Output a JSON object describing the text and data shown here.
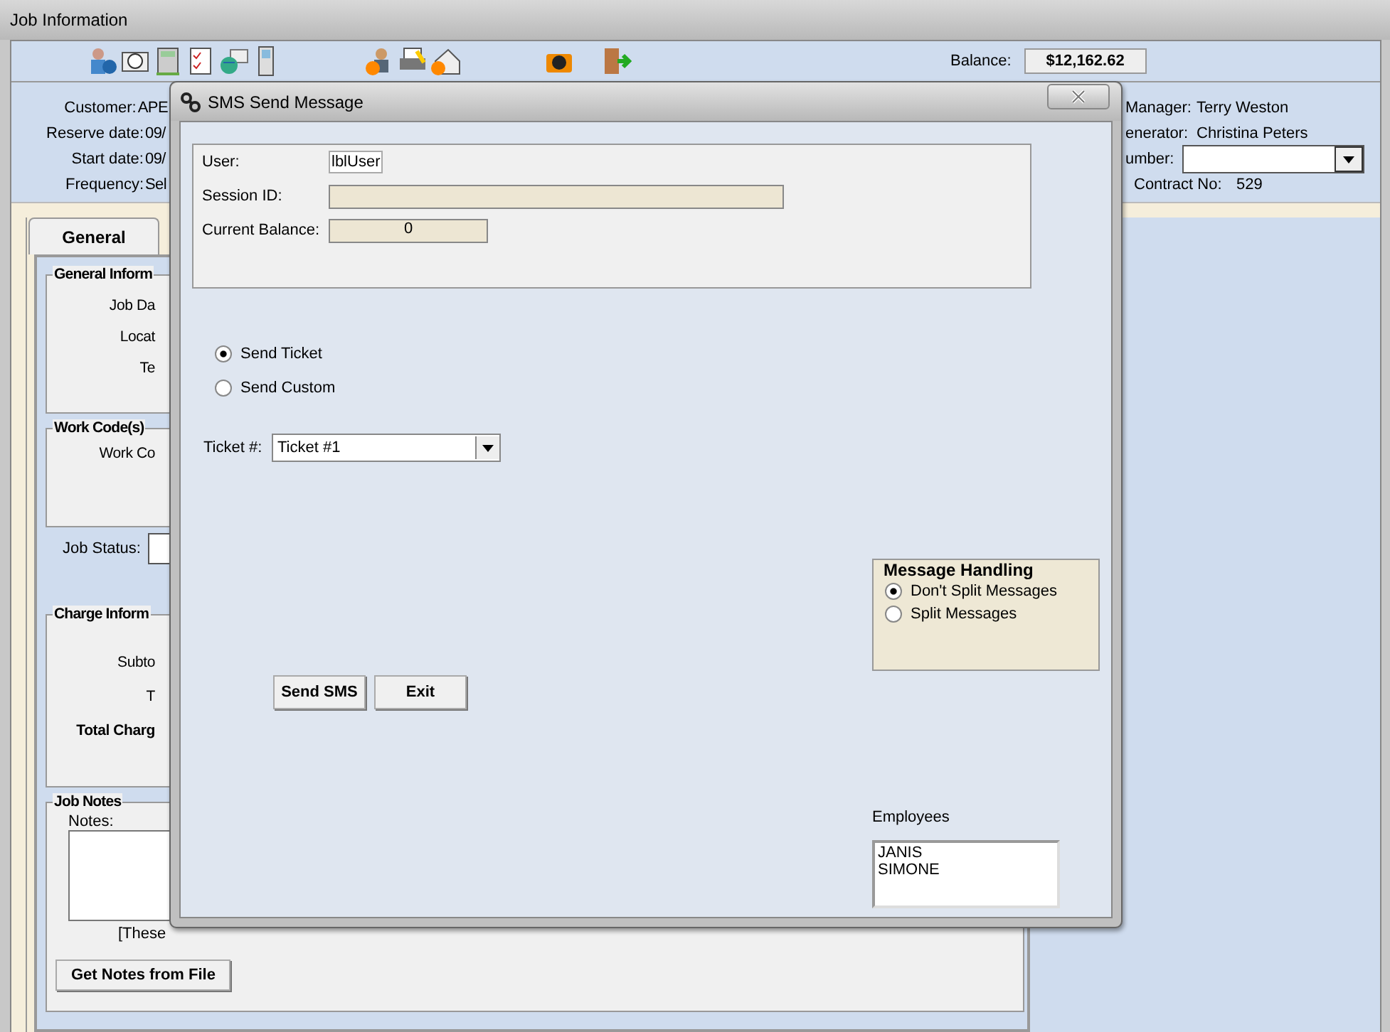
{
  "window": {
    "title": "Job Information"
  },
  "toolbar": {
    "balance_label": "Balance:",
    "balance": "$12,162.62"
  },
  "info_left": [
    {
      "label": "Customer:",
      "value": "APE"
    },
    {
      "label": "Reserve date:",
      "value": "09/"
    },
    {
      "label": "Start date:",
      "value": "09/"
    },
    {
      "label": "Frequency:",
      "value": "Sel"
    }
  ],
  "info_right": [
    {
      "kind": "text",
      "label": "Manager:",
      "value": "Terry Weston"
    },
    {
      "kind": "text",
      "label": "enerator:",
      "value": "Christina Peters"
    },
    {
      "kind": "dropdown",
      "label": "umber:"
    },
    {
      "kind": "text",
      "label": "Contract No:",
      "value": "529"
    }
  ],
  "tabs": [
    {
      "label": "General",
      "selected": true
    }
  ],
  "groups": [
    {
      "title": "General Inform",
      "labels": [
        "Job Da",
        "Locat",
        "Te"
      ]
    },
    {
      "title": "Work Code(s)",
      "labels": [
        "Work Co"
      ]
    },
    {
      "title": "Charge Inform",
      "labels": [
        "Subto",
        "T",
        "Total Charg"
      ]
    }
  ],
  "job_status_label": "Job Status:",
  "job_notes": {
    "title": "Job Notes",
    "notes_label": "Notes:",
    "hint_left": "[These",
    "button": "Get Notes from File"
  },
  "dialog": {
    "title": "SMS Send Message",
    "user_label": "User:",
    "user": "lblUser",
    "session_label": "Session ID:",
    "balance_label": "Current Balance:",
    "balance": "0",
    "send_options": [
      {
        "label": "Send Ticket",
        "selected": true
      },
      {
        "label": "Send Custom",
        "selected": false
      }
    ],
    "ticket_label": "Ticket #:",
    "ticket": "Ticket #1",
    "message_handling": {
      "title": "Message Handling",
      "options": [
        {
          "label": "Don't Split Messages",
          "selected": true
        },
        {
          "label": "Split Messages",
          "selected": false
        }
      ]
    },
    "buttons": [
      "Send SMS",
      "Exit"
    ],
    "employees_label": "Employees",
    "employees": [
      "JANIS",
      "SIMONE"
    ]
  }
}
